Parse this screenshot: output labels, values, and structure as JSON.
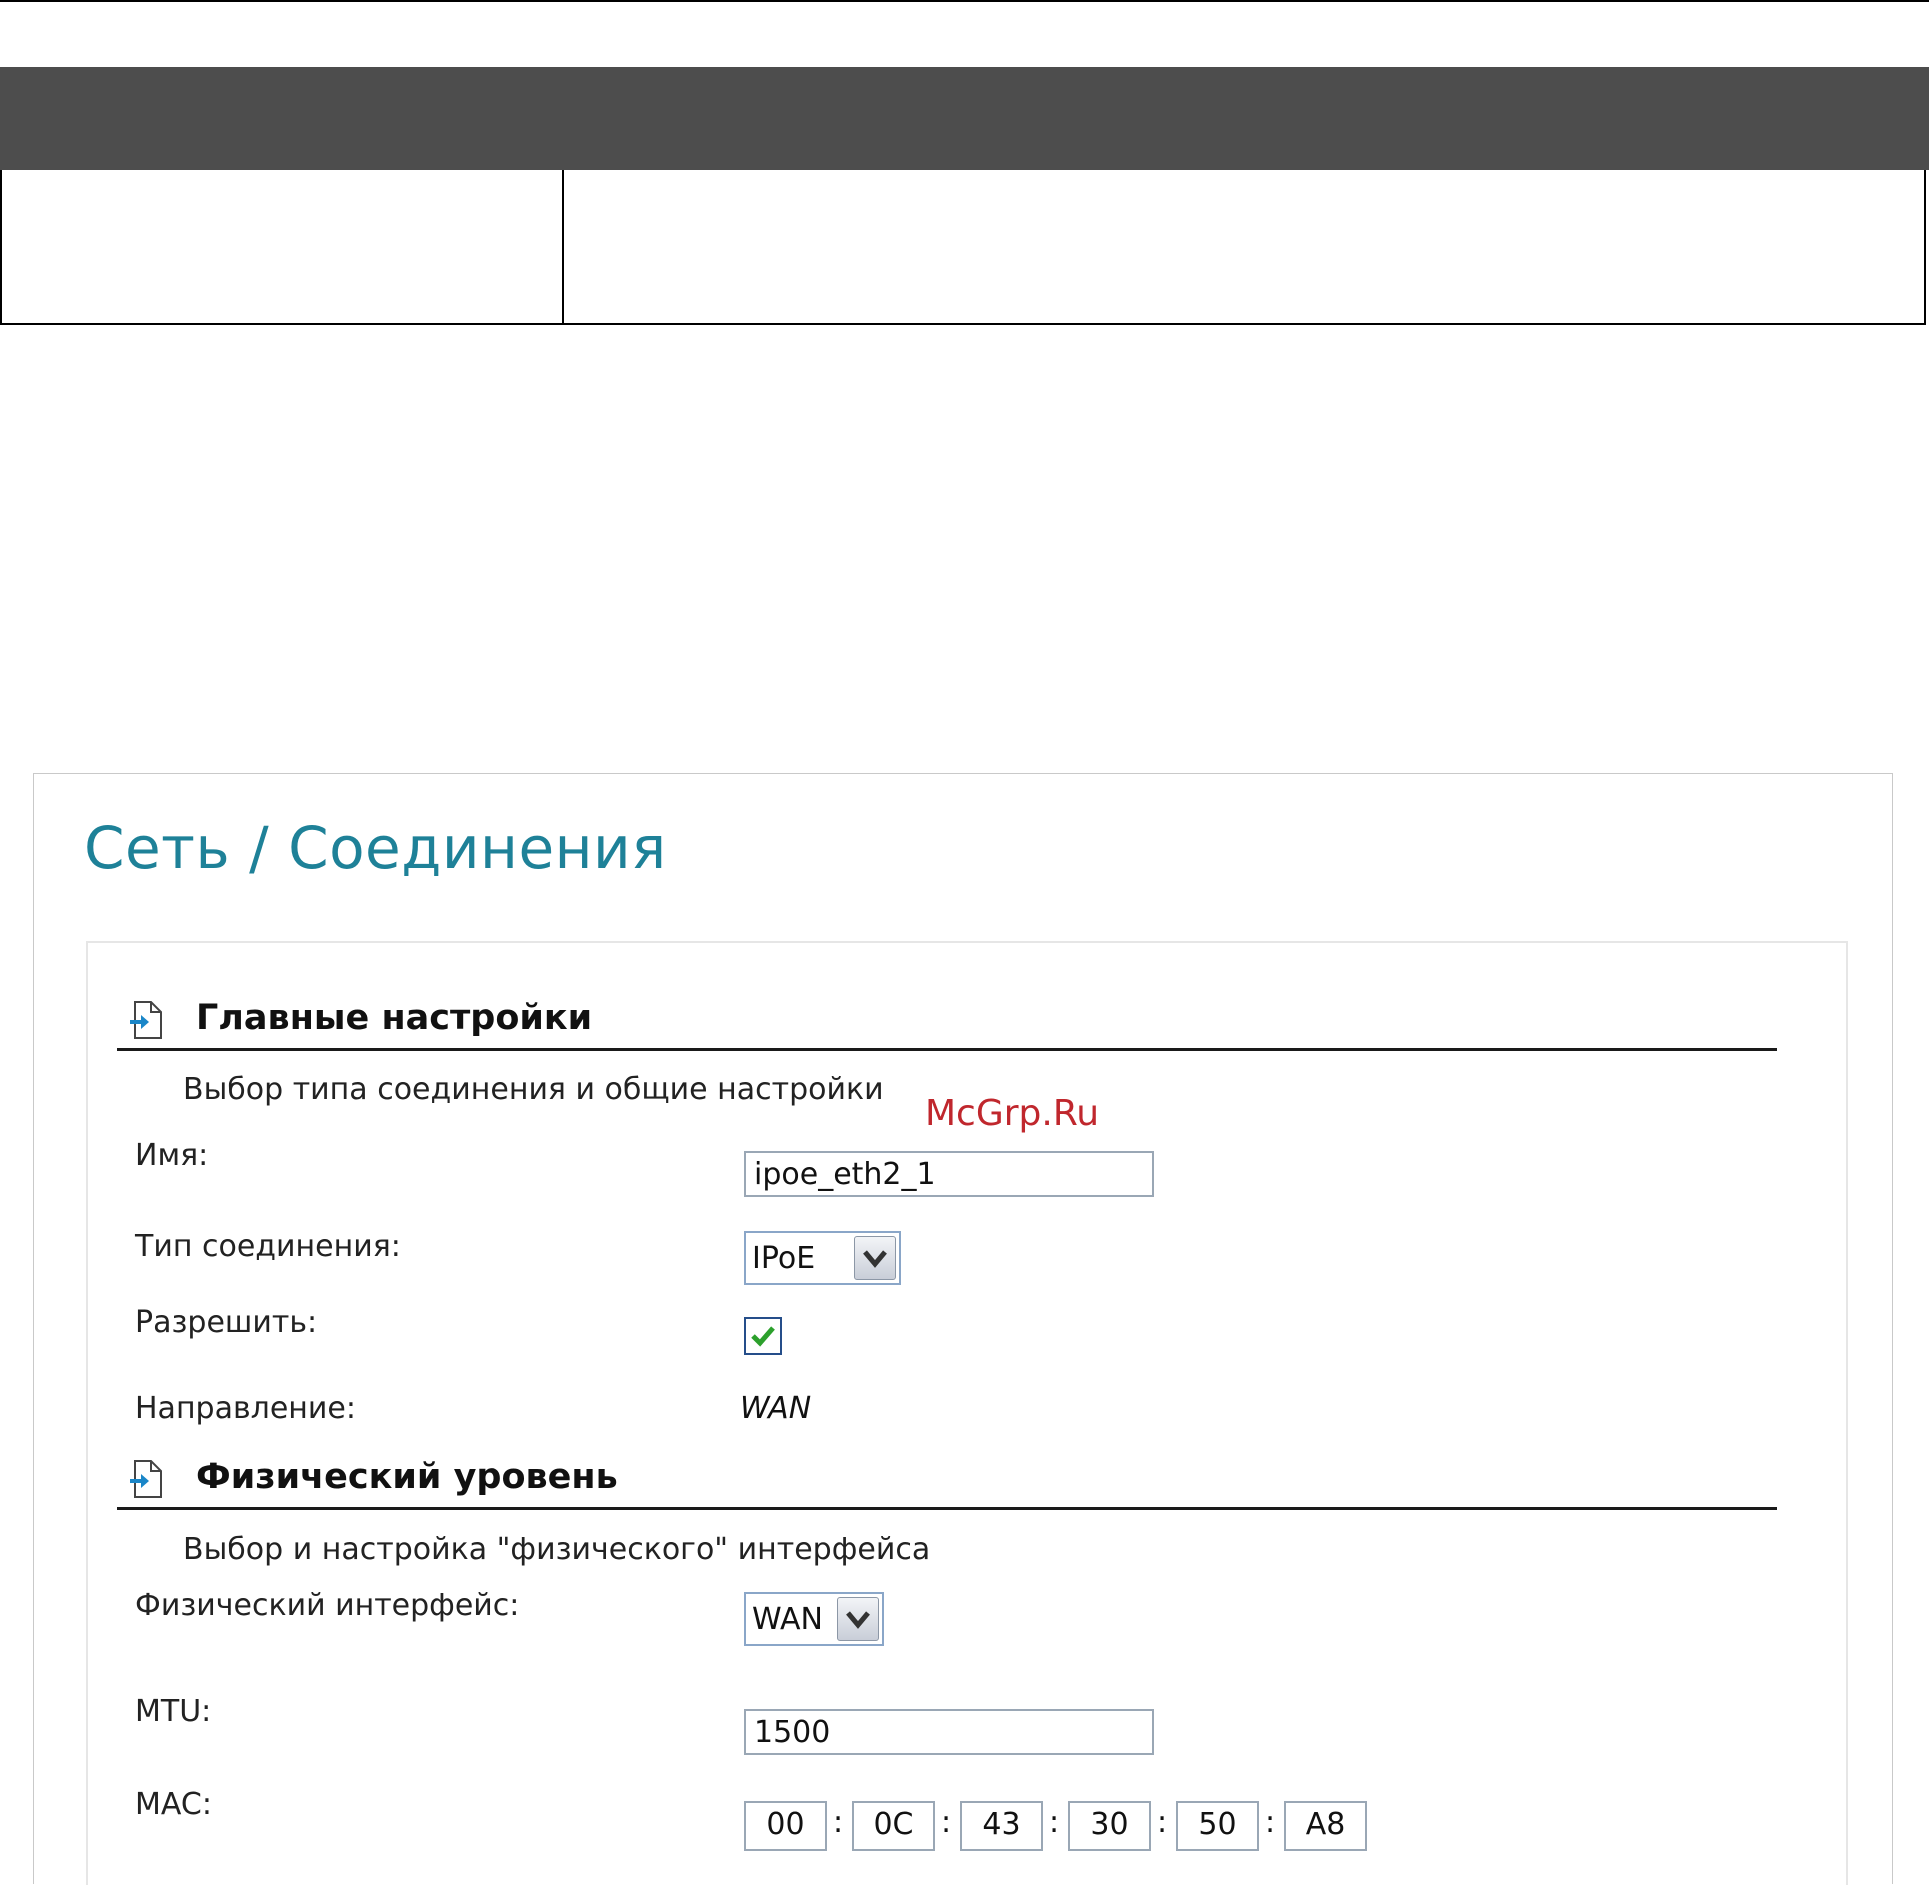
{
  "page_title": "Сеть / Соединения",
  "watermark": "McGrp.Ru",
  "main_settings": {
    "title": "Главные настройки",
    "description": "Выбор типа соединения и общие настройки",
    "name_label": "Имя:",
    "name_value": "ipoe_eth2_1",
    "type_label": "Тип соединения:",
    "type_value": "IPoE",
    "enable_label": "Разрешить:",
    "enable_checked": true,
    "direction_label": "Направление:",
    "direction_value": "WAN"
  },
  "physical": {
    "title": "Физический уровень",
    "description": "Выбор и настройка \"физического\" интерфейса",
    "interface_label": "Физический интерфейс:",
    "interface_value": "WAN",
    "mtu_label": "MTU:",
    "mtu_value": "1500",
    "mac_label": "MAC:",
    "mac_octets": [
      "00",
      "0C",
      "43",
      "30",
      "50",
      "A8"
    ],
    "mac_separator": ":"
  },
  "colors": {
    "title": "#1e8198",
    "watermark": "#c0272d",
    "table_header": "#4d4d4d",
    "check": "#2ca02c"
  },
  "icons": {
    "section_icon": "page-arrow-icon",
    "dropdown_icon": "chevron-down-icon",
    "check_icon": "checkmark-icon"
  }
}
